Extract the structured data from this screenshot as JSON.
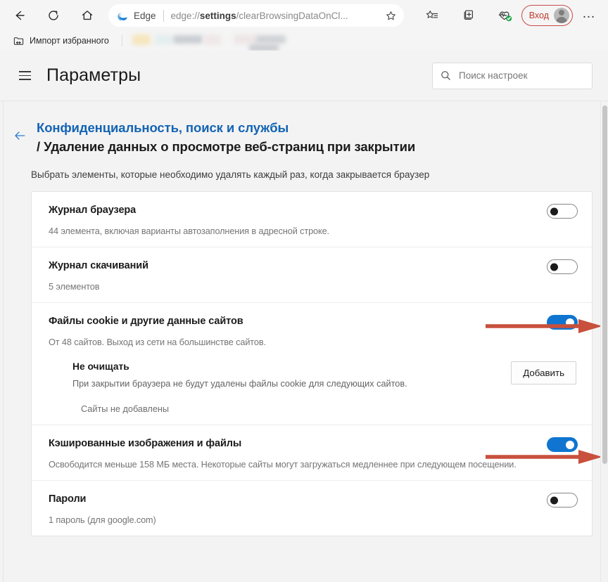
{
  "browser": {
    "nav": {
      "back": "back-arrow",
      "reload": "reload-icon",
      "home": "home-icon"
    },
    "address": {
      "brand": "Edge",
      "url_prefix": "edge://",
      "url_bold": "settings",
      "url_suffix": "/clearBrowsingDataOnCl...",
      "full_url": "edge://settings/clearBrowsingDataOnCl...",
      "favorite_icon": "star-icon"
    },
    "toolbar_right": {
      "favorites_icon": "favorites-star-list-icon",
      "collections_icon": "collections-add-icon",
      "essentials_icon": "browser-essentials-heartbeat-icon",
      "signin_label": "Вход",
      "avatar": "profile-avatar",
      "more_label": "…"
    },
    "bookmarks": {
      "import_label": "Импорт избранного",
      "import_icon": "import-favorites-icon"
    }
  },
  "settings": {
    "header": {
      "menu_icon": "hamburger-menu-icon",
      "title": "Параметры",
      "search_placeholder": "Поиск настроек",
      "search_value": "",
      "search_icon": "search-icon"
    },
    "breadcrumb": {
      "back_icon": "back-arrow-icon",
      "parent": "Конфиденциальность, поиск и службы",
      "current": "/ Удаление данных о просмотре веб-страниц при закрытии"
    },
    "page_description": "Выбрать элементы, которые необходимо удалять каждый раз, когда закрывается браузер",
    "rows": [
      {
        "title": "Журнал браузера",
        "subtitle": "44 элемента, включая варианты автозаполнения в адресной строке.",
        "toggle_state": "off"
      },
      {
        "title": "Журнал скачиваний",
        "subtitle": "5 элементов",
        "toggle_state": "off"
      },
      {
        "title": "Файлы cookie и другие данные сайтов",
        "subtitle": "От 48 сайтов. Выход из сети на большинстве сайтов.",
        "toggle_state": "on",
        "nested": {
          "title": "Не очищать",
          "subtitle": "При закрытии браузера не будут удалены файлы cookie для следующих сайтов.",
          "empty_text": "Сайты не добавлены",
          "add_button": "Добавить"
        }
      },
      {
        "title": "Кэшированные изображения и файлы",
        "subtitle": "Освободится меньше 158 МБ места. Некоторые сайты могут загружаться медленнее при следующем посещении.",
        "toggle_state": "on"
      },
      {
        "title": "Пароли",
        "subtitle": "1 пароль (для google.com)",
        "toggle_state": "off"
      }
    ]
  },
  "annotations": {
    "arrow_color": "#c8503c",
    "arrows": [
      {
        "name": "arrow-to-cookies-toggle"
      },
      {
        "name": "arrow-to-cache-toggle"
      }
    ]
  },
  "colors": {
    "accent_blue": "#0f75d0",
    "link_blue": "#1464b4",
    "signin_red": "#c0392b",
    "page_bg": "#f3f3f3",
    "card_bg": "#ffffff"
  }
}
